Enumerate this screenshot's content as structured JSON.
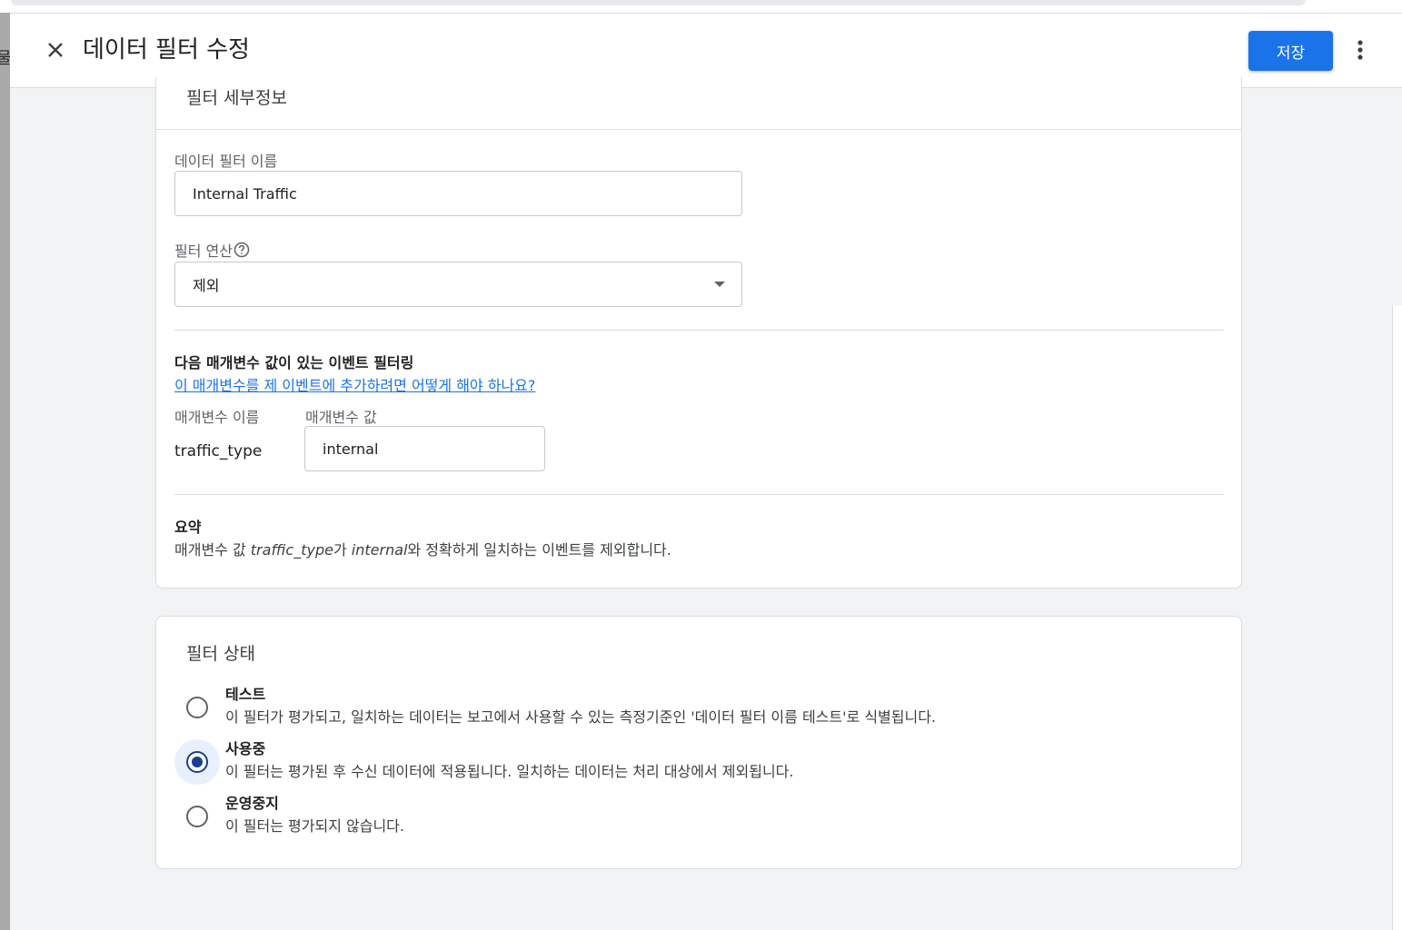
{
  "background": {
    "peek_text": "물"
  },
  "header": {
    "title": "데이터 필터 수정",
    "save_label": "저장"
  },
  "details": {
    "title": "필터 세부정보",
    "name_label": "데이터 필터 이름",
    "name_value": "Internal Traffic",
    "operation_label": "필터 연산",
    "operation_value": "제외",
    "param_section_title": "다음 매개변수 값이 있는 이벤트 필터링",
    "help_link": "이 매개변수를 제 이벤트에 추가하려면 어떻게 해야 하나요?",
    "param_name_header": "매개변수 이름",
    "param_value_header": "매개변수 값",
    "param_name": "traffic_type",
    "param_value": "internal",
    "summary_title": "요약",
    "summary": {
      "prefix": "매개변수 값 ",
      "param": "traffic_type",
      "mid": "가 ",
      "value": "internal",
      "suffix": "와 정확하게 일치하는 이벤트를 제외합니다."
    }
  },
  "status": {
    "title": "필터 상태",
    "options": [
      {
        "title": "테스트",
        "desc": "이 필터가 평가되고, 일치하는 데이터는 보고에서 사용할 수 있는 측정기준인 '데이터 필터 이름 테스트'로 식별됩니다.",
        "selected": false
      },
      {
        "title": "사용중",
        "desc": "이 필터는 평가된 후 수신 데이터에 적용됩니다. 일치하는 데이터는 처리 대상에서 제외됩니다.",
        "selected": true
      },
      {
        "title": "운영중지",
        "desc": "이 필터는 평가되지 않습니다.",
        "selected": false
      }
    ]
  },
  "colors": {
    "accent": "#1a73e8",
    "radio_selected": "#1a3f8c",
    "radio_halo": "#e8f0fe"
  },
  "icons": {
    "close": "close-icon",
    "more": "more-vert-icon",
    "help": "help-circle-icon",
    "dropdown": "dropdown-arrow-icon"
  }
}
